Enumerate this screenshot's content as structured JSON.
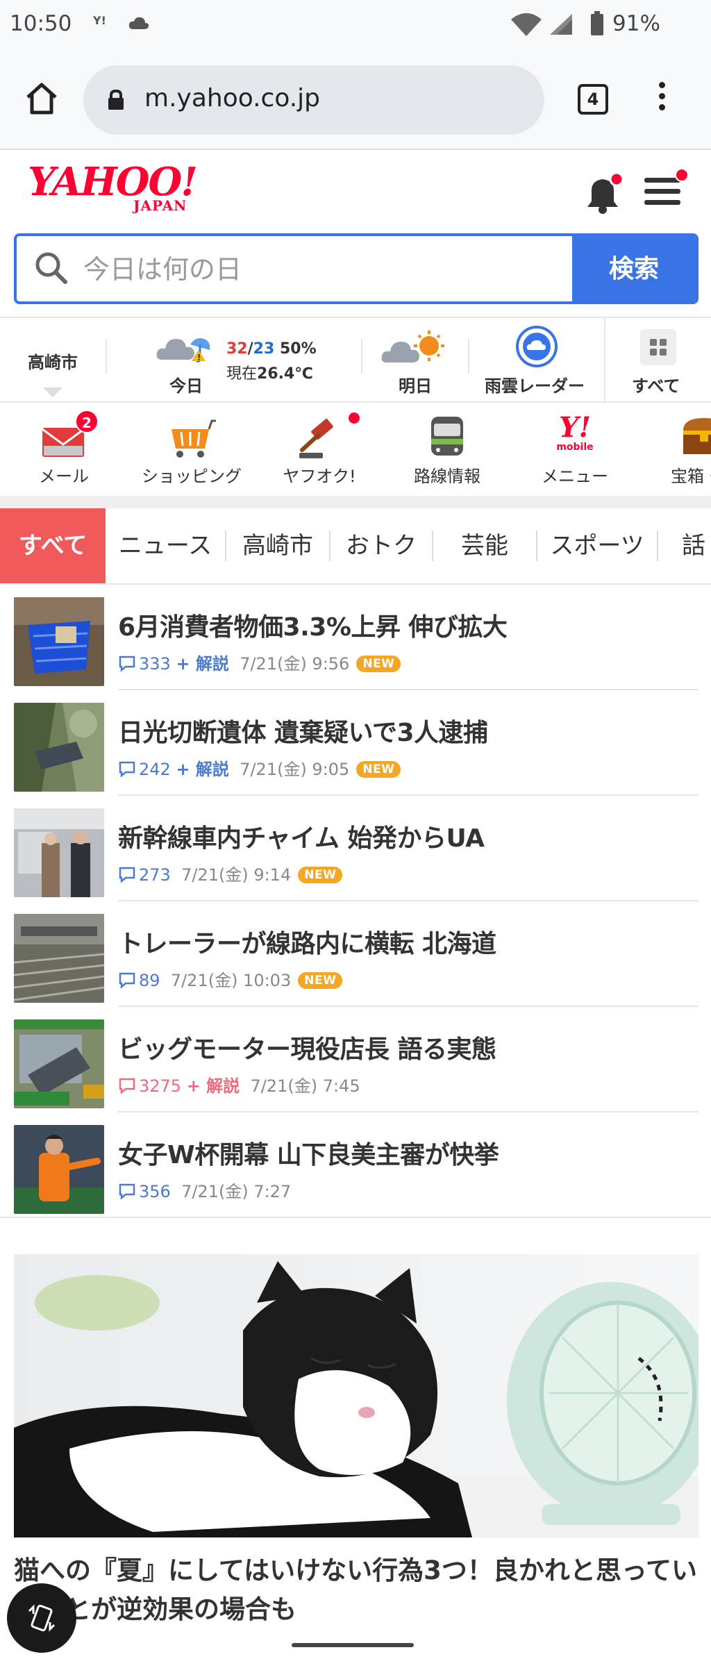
{
  "status": {
    "time": "10:50",
    "notif_badge": "Y!",
    "battery": "91%"
  },
  "browser": {
    "url": "m.yahoo.co.jp",
    "tab_count": "4"
  },
  "header": {
    "logo_main": "YAHOO!",
    "logo_sub": "JAPAN"
  },
  "search": {
    "placeholder": "今日は何の日",
    "button": "検索"
  },
  "weather": {
    "city": "高崎市",
    "today_label": "今日",
    "high": "32",
    "slash": "/",
    "low": "23",
    "precip": "50%",
    "now_prefix": "現在",
    "now_temp": "26.4℃",
    "tomorrow_label": "明日",
    "radar_label": "雨雲レーダー",
    "all_label": "すべて"
  },
  "services": [
    {
      "label": "メール",
      "badge": "2"
    },
    {
      "label": "ショッピング"
    },
    {
      "label": "ヤフオク!"
    },
    {
      "label": "路線情報"
    },
    {
      "label": "メニュー",
      "logo": "Y!",
      "logo_sub": "mobile"
    },
    {
      "label": "宝箱・"
    }
  ],
  "categories": [
    "すべて",
    "ニュース",
    "高崎市",
    "おトク",
    "芸能",
    "スポーツ",
    "話"
  ],
  "news": [
    {
      "title": "6月消費者物価3.3%上昇 伸び拡大",
      "comments": "333",
      "kaisetsu": "+ 解説",
      "date": "7/21(金) 9:56",
      "new": "NEW"
    },
    {
      "title": "日光切断遺体 遺棄疑いで3人逮捕",
      "comments": "242",
      "kaisetsu": "+ 解説",
      "date": "7/21(金) 9:05",
      "new": "NEW"
    },
    {
      "title": "新幹線車内チャイム 始発からUA",
      "comments": "273",
      "date": "7/21(金) 9:14",
      "new": "NEW"
    },
    {
      "title": "トレーラーが線路内に横転 北海道",
      "comments": "89",
      "date": "7/21(金) 10:03",
      "new": "NEW"
    },
    {
      "title": "ビッグモーター現役店長 語る実態",
      "comments": "3275",
      "kaisetsu": "+ 解説",
      "date": "7/21(金) 7:45",
      "hot": true
    },
    {
      "title": "女子W杯開幕 山下良美主審が快挙",
      "comments": "356",
      "date": "7/21(金) 7:27"
    }
  ],
  "feature": {
    "title": "猫への『夏』にしてはいけない行為3つ！良かれと思っていたことが逆効果の場合も"
  }
}
